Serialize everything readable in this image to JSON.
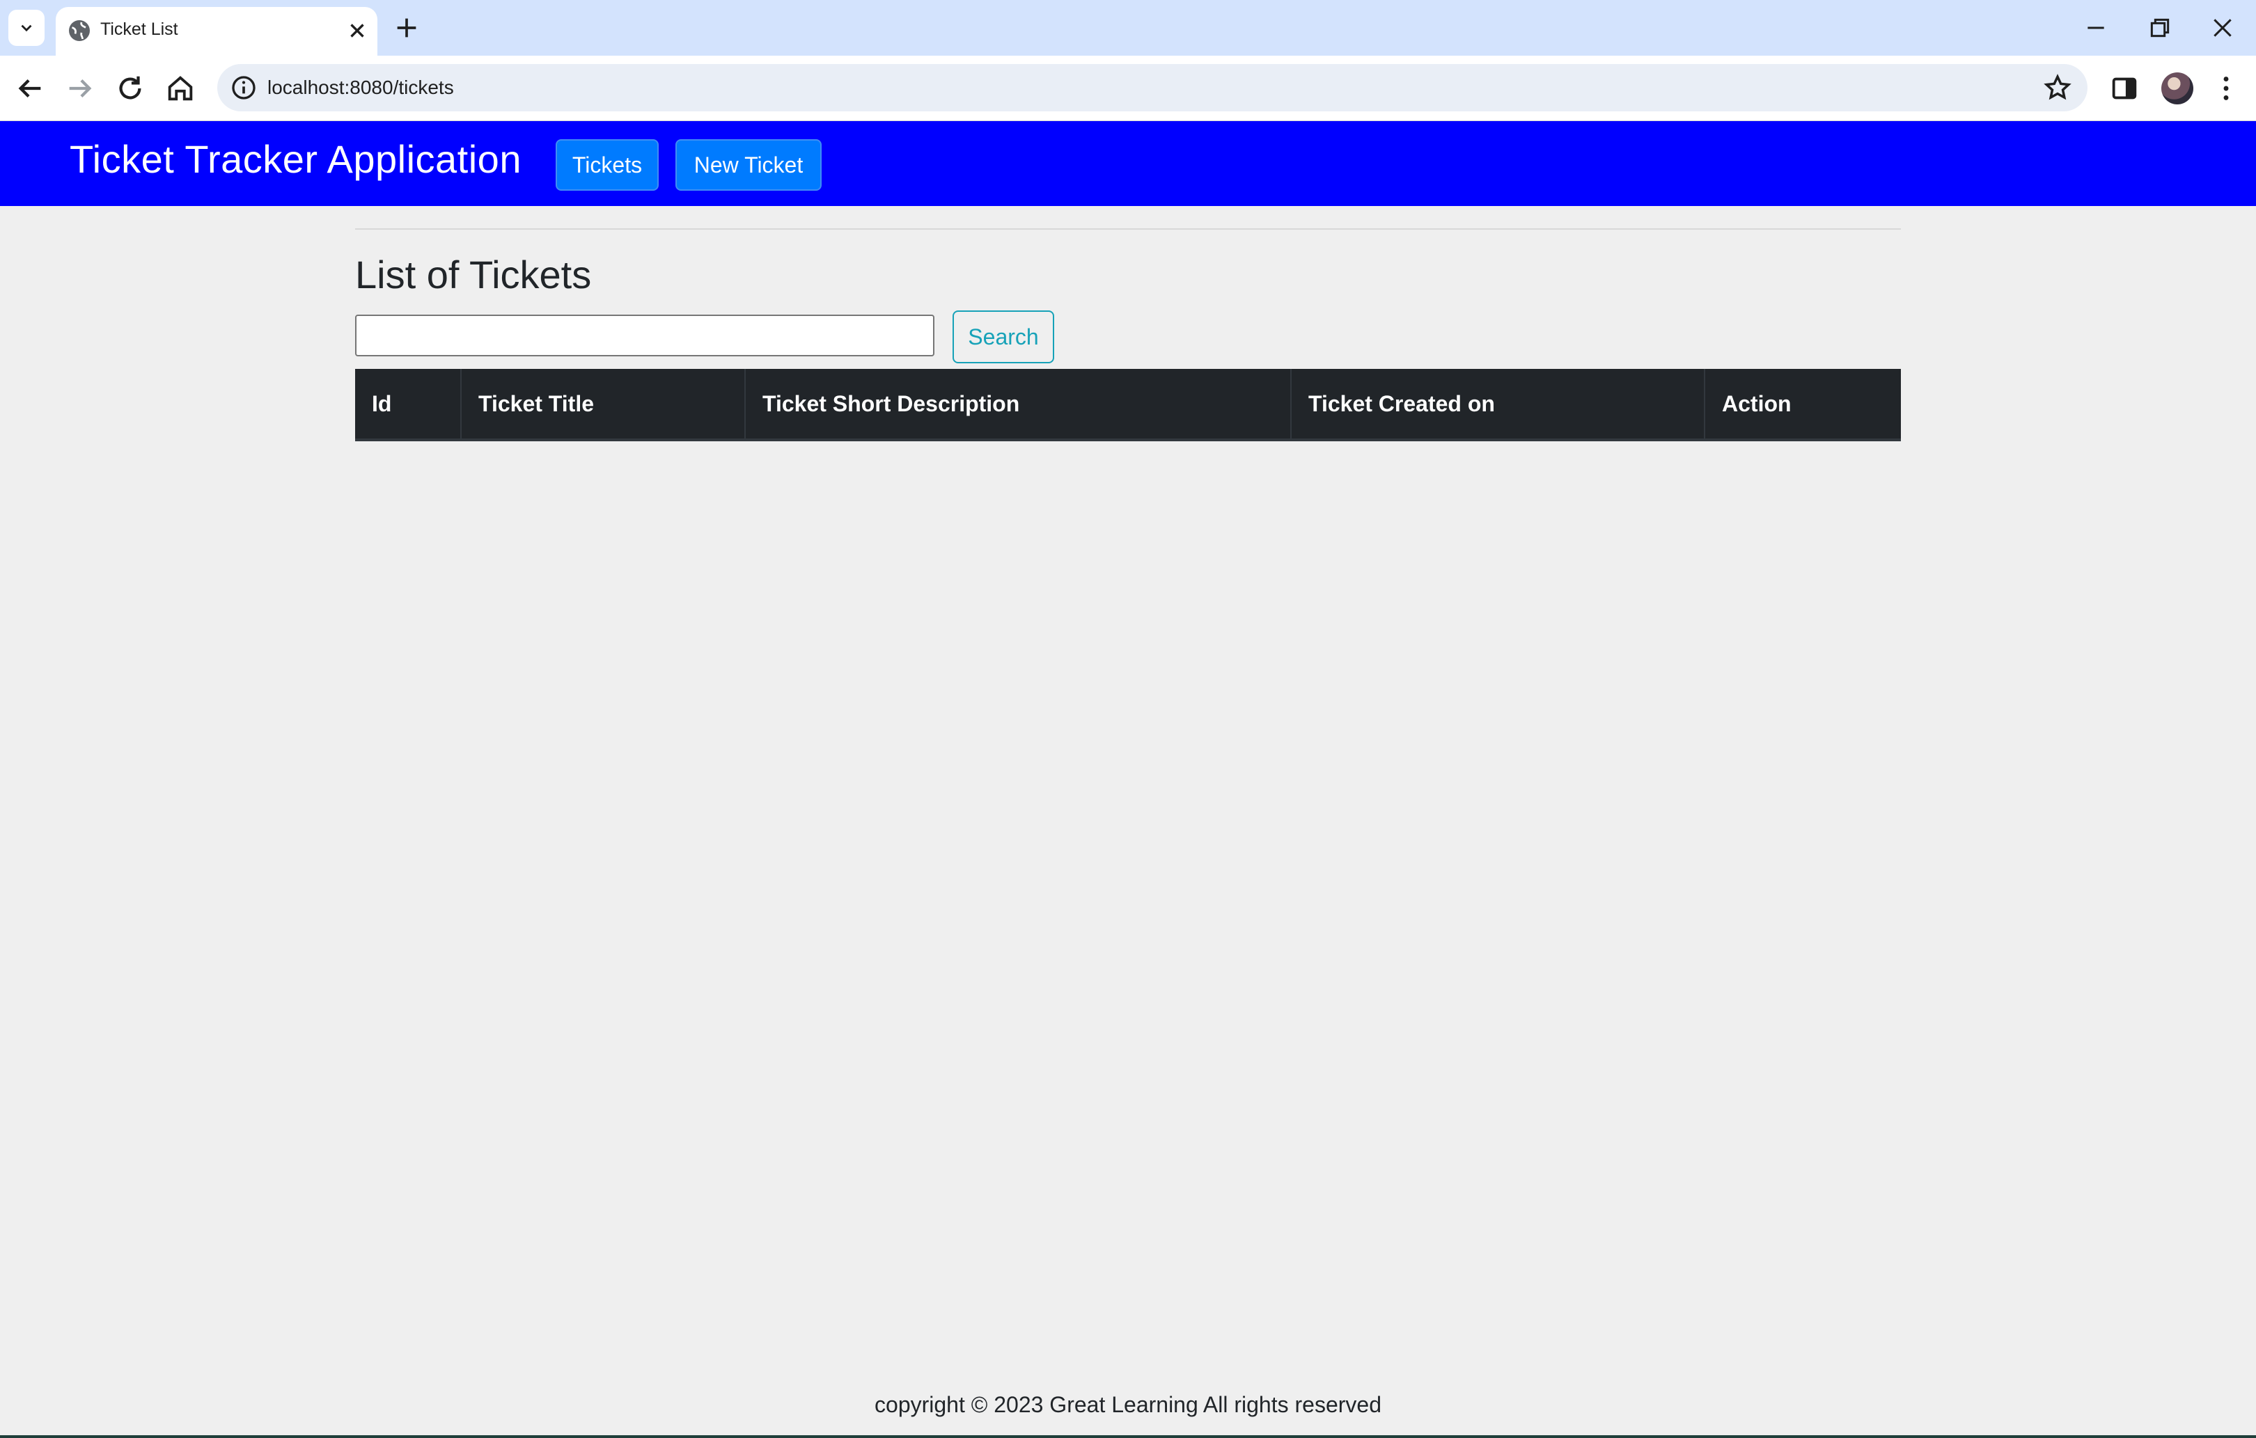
{
  "browser": {
    "tab_title": "Ticket List",
    "url": "localhost:8080/tickets"
  },
  "navbar": {
    "brand": "Ticket Tracker Application",
    "tickets_label": "Tickets",
    "new_ticket_label": "New Ticket"
  },
  "main": {
    "title": "List of Tickets",
    "search_value": "",
    "search_button_label": "Search",
    "table": {
      "headers": [
        "Id",
        "Ticket Title",
        "Ticket Short Description",
        "Ticket Created on",
        "Action"
      ],
      "rows": []
    }
  },
  "footer": {
    "text": "copyright © 2023 Great Learning All rights reserved"
  },
  "colors": {
    "navbar_bg": "#0000ff",
    "nav_button_bg": "#007bff",
    "table_header_bg": "#212529",
    "search_button_accent": "#17a2b8",
    "page_bg": "#efefef"
  }
}
